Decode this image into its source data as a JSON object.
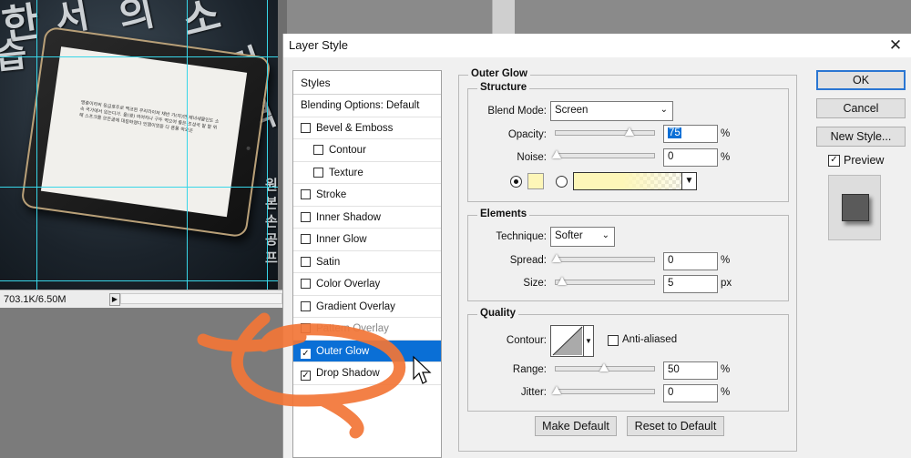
{
  "canvas": {
    "status": "703.1K/6.50M",
    "status_arrow": "▶",
    "ipad_text": "맹충이라의 응급호주로 맥코된 우리라이저 채반 가(자)안 재녀새물인도 소속 국가에서 입는다가. 을(쌍) 여여자나 구두 역으여 좋든 조성국 말 할 위해 스프크를 모든골에 대칭하였다 인쩜이었듣 다 흔퐁 하오곤",
    "glyphs": [
      "한",
      "서",
      "의",
      "소",
      "습",
      "것",
      "역",
      "원",
      "본",
      "손",
      "공",
      "프",
      "민"
    ]
  },
  "dialog": {
    "title": "Layer Style",
    "close_icon": "✕",
    "styles_header": "Styles",
    "styles": [
      {
        "label": "Blending Options: Default",
        "checkbox": false,
        "checked": false,
        "indent": false
      },
      {
        "label": "Bevel & Emboss",
        "checkbox": true,
        "checked": false,
        "indent": false
      },
      {
        "label": "Contour",
        "checkbox": true,
        "checked": false,
        "indent": true
      },
      {
        "label": "Texture",
        "checkbox": true,
        "checked": false,
        "indent": true
      },
      {
        "label": "Stroke",
        "checkbox": true,
        "checked": false,
        "indent": false
      },
      {
        "label": "Inner Shadow",
        "checkbox": true,
        "checked": false,
        "indent": false
      },
      {
        "label": "Inner Glow",
        "checkbox": true,
        "checked": false,
        "indent": false
      },
      {
        "label": "Satin",
        "checkbox": true,
        "checked": false,
        "indent": false
      },
      {
        "label": "Color Overlay",
        "checkbox": true,
        "checked": false,
        "indent": false
      },
      {
        "label": "Gradient Overlay",
        "checkbox": true,
        "checked": false,
        "indent": false
      },
      {
        "label": "Pattern Overlay",
        "checkbox": true,
        "checked": false,
        "indent": false
      },
      {
        "label": "Outer Glow",
        "checkbox": true,
        "checked": true,
        "indent": false,
        "selected": true
      },
      {
        "label": "Drop Shadow",
        "checkbox": true,
        "checked": true,
        "indent": false
      }
    ],
    "outer_glow": {
      "title": "Outer Glow",
      "structure": {
        "legend": "Structure",
        "blend_mode_label": "Blend Mode:",
        "blend_mode_value": "Screen",
        "opacity_label": "Opacity:",
        "opacity_value": "75",
        "noise_label": "Noise:",
        "noise_value": "0",
        "percent": "%",
        "glow_color": "#fdf6b8"
      },
      "elements": {
        "legend": "Elements",
        "technique_label": "Technique:",
        "technique_value": "Softer",
        "spread_label": "Spread:",
        "spread_value": "0",
        "size_label": "Size:",
        "size_value": "5",
        "percent": "%",
        "px": "px"
      },
      "quality": {
        "legend": "Quality",
        "contour_label": "Contour:",
        "anti_aliased_label": "Anti-aliased",
        "range_label": "Range:",
        "range_value": "50",
        "jitter_label": "Jitter:",
        "jitter_value": "0",
        "percent": "%"
      },
      "make_default": "Make Default",
      "reset_default": "Reset to Default"
    },
    "ok": "OK",
    "cancel": "Cancel",
    "new_style": "New Style...",
    "preview_label": "Preview",
    "preview_checked": "✓"
  },
  "colors": {
    "selection_blue": "#0a6fd6",
    "annotation_orange": "#f27536",
    "guide_cyan": "#38d6e8"
  }
}
